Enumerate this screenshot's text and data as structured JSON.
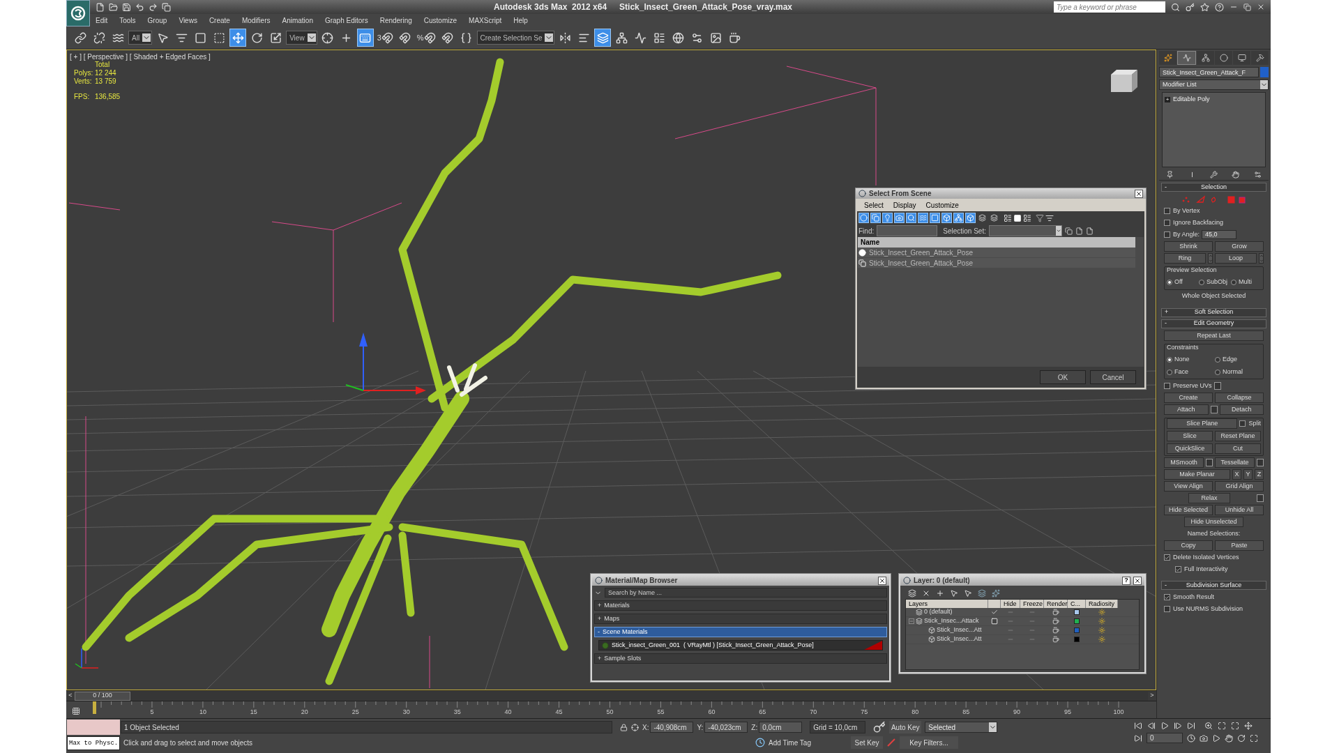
{
  "window": {
    "app_title": "Autodesk 3ds Max  2012 x64",
    "file_title": "Stick_Insect_Green_Attack_Pose_vray.max",
    "search_placeholder": "Type a keyword or phrase"
  },
  "menu": [
    "Edit",
    "Tools",
    "Group",
    "Views",
    "Create",
    "Modifiers",
    "Animation",
    "Graph Editors",
    "Rendering",
    "Customize",
    "MAXScript",
    "Help"
  ],
  "toolbar": [
    {
      "kind": "button",
      "selected": false
    },
    {
      "kind": "button",
      "selected": false
    },
    {
      "kind": "button",
      "selected": false
    },
    {
      "kind": "dropdown",
      "value": "All"
    },
    {
      "kind": "button",
      "selected": false
    },
    {
      "kind": "button",
      "selected": false
    },
    {
      "kind": "button",
      "selected": false
    },
    {
      "kind": "button",
      "selected": false
    },
    {
      "kind": "button",
      "selected": true
    },
    {
      "kind": "button",
      "selected": false
    },
    {
      "kind": "button",
      "selected": false
    },
    {
      "kind": "dropdown",
      "value": "View"
    },
    {
      "kind": "button",
      "selected": false
    },
    {
      "kind": "button",
      "selected": false
    },
    {
      "kind": "button",
      "selected": true
    },
    {
      "kind": "button",
      "selected": false,
      "label": "3"
    },
    {
      "kind": "button",
      "selected": false
    },
    {
      "kind": "button",
      "selected": false,
      "label": "%"
    },
    {
      "kind": "button",
      "selected": false
    },
    {
      "kind": "button",
      "selected": false
    },
    {
      "kind": "dropdown",
      "value": "Create Selection Se"
    },
    {
      "kind": "button",
      "selected": false
    },
    {
      "kind": "button",
      "selected": false
    },
    {
      "kind": "button",
      "selected": true
    },
    {
      "kind": "button",
      "selected": false
    },
    {
      "kind": "button",
      "selected": false
    },
    {
      "kind": "button",
      "selected": false
    },
    {
      "kind": "button",
      "selected": false
    },
    {
      "kind": "button",
      "selected": false
    },
    {
      "kind": "button",
      "selected": false
    },
    {
      "kind": "button",
      "selected": false
    }
  ],
  "viewport": {
    "label": "[ + ] [ Perspective ] [ Shaded + Edged Faces ]",
    "stats_heading": "Total",
    "stats": [
      {
        "label": "Polys:",
        "value": "12 244"
      },
      {
        "label": "Verts:",
        "value": "13 759"
      }
    ],
    "fps_label": "FPS:",
    "fps_value": "136,585"
  },
  "select_from_scene": {
    "title": "Select From Scene",
    "menu": [
      "Select",
      "Display",
      "Customize"
    ],
    "filters": [
      {
        "selected": true
      },
      {
        "selected": true
      },
      {
        "selected": true
      },
      {
        "selected": true
      },
      {
        "selected": true
      },
      {
        "selected": true
      },
      {
        "selected": true
      },
      {
        "selected": true
      },
      {
        "selected": true
      },
      {
        "selected": true
      },
      {
        "selected": false
      },
      {
        "selected": false
      }
    ],
    "find_label": "Find:",
    "selection_set_label": "Selection Set:",
    "column": "Name",
    "rows": [
      {
        "kind": "geometry",
        "name": "Stick_Insect_Green_Attack_Pose"
      },
      {
        "kind": "group",
        "name": "Stick_Insect_Green_Attack_Pose"
      }
    ],
    "buttons": [
      "OK",
      "Cancel"
    ]
  },
  "material_browser": {
    "title": "Material/Map Browser",
    "search_placeholder": "Search by Name ...",
    "items": [
      {
        "kind": "section",
        "sign": "+",
        "label": "Materials",
        "selected": false
      },
      {
        "kind": "section",
        "sign": "+",
        "label": "Maps",
        "selected": false
      },
      {
        "kind": "section",
        "sign": "-",
        "label": "Scene Materials",
        "selected": true
      },
      {
        "kind": "material",
        "label": "Stick_insect_Green_001  ( VRayMtl ) [Stick_Insect_Green_Attack_Pose]"
      },
      {
        "kind": "section",
        "sign": "+",
        "label": "Sample Slots",
        "selected": false
      }
    ]
  },
  "layer_dialog": {
    "title": "Layer: 0 (default)",
    "help": "?",
    "columns": [
      "Layers",
      "Hide",
      "Freeze",
      "Render",
      "C...",
      "Radiosity"
    ],
    "rows": [
      {
        "name": "0 (default)",
        "current": true,
        "color": "#a8c8ec"
      },
      {
        "name": "Stick_Insec...Attack",
        "current": false,
        "color": "#20b050",
        "expanded": true,
        "children": [
          {
            "name": "Stick_Insec...Att",
            "color": "#2060c0"
          },
          {
            "name": "Stick_Insec...Att",
            "color": "#000000"
          }
        ]
      }
    ]
  },
  "command_panel": {
    "tabs": [
      {
        "selected": false
      },
      {
        "selected": true
      },
      {
        "selected": false
      },
      {
        "selected": false
      },
      {
        "selected": false
      },
      {
        "selected": false
      }
    ],
    "object_name": "Stick_Insect_Green_Attack_F",
    "modifier_list": "Modifier List",
    "stack": [
      {
        "sign": "+",
        "label": "Editable Poly"
      }
    ],
    "rollouts": [
      {
        "sign": "-",
        "title": "Selection",
        "expanded": true,
        "rows": [
          {
            "items": [
              {
                "kind": "subobject_icons"
              }
            ]
          },
          {
            "items": [
              {
                "kind": "checkbox",
                "label": "By Vertex",
                "checked": false
              }
            ]
          },
          {
            "items": [
              {
                "kind": "checkbox",
                "label": "Ignore Backfacing",
                "checked": false
              }
            ]
          },
          {
            "items": [
              {
                "kind": "checkbox",
                "label": "By Angle:",
                "checked": false
              },
              {
                "kind": "spinner_field",
                "value": "45,0"
              }
            ]
          },
          {
            "items": [
              {
                "kind": "button",
                "label": "Shrink"
              },
              {
                "kind": "button",
                "label": "Grow"
              }
            ]
          },
          {
            "items": [
              {
                "kind": "button",
                "label": "Ring"
              },
              {
                "kind": "spinner"
              },
              {
                "kind": "button",
                "label": "Loop"
              },
              {
                "kind": "spinner"
              }
            ]
          },
          {
            "group": "Preview Selection",
            "rows": [
              {
                "items": [
                  {
                    "kind": "radio",
                    "label": "Off",
                    "selected": true
                  },
                  {
                    "kind": "radio",
                    "label": "SubObj",
                    "selected": false
                  },
                  {
                    "kind": "radio",
                    "label": "Multi",
                    "selected": false
                  }
                ]
              }
            ]
          },
          {
            "items": [
              {
                "kind": "text",
                "label": "Whole Object Selected"
              }
            ]
          }
        ]
      },
      {
        "sign": "+",
        "title": "Soft Selection",
        "expanded": false
      },
      {
        "sign": "-",
        "title": "Edit Geometry",
        "expanded": true,
        "rows": [
          {
            "items": [
              {
                "kind": "button",
                "label": "Repeat Last"
              }
            ]
          },
          {
            "group": "Constraints",
            "rows": [
              {
                "items": [
                  {
                    "kind": "radio",
                    "label": "None",
                    "selected": true
                  },
                  {
                    "kind": "radio",
                    "label": "Edge",
                    "selected": false
                  }
                ]
              },
              {
                "items": [
                  {
                    "kind": "radio",
                    "label": "Face",
                    "selected": false
                  },
                  {
                    "kind": "radio",
                    "label": "Normal",
                    "selected": false
                  }
                ]
              }
            ]
          },
          {
            "items": [
              {
                "kind": "checkbox",
                "label": "Preserve UVs",
                "checked": false
              },
              {
                "kind": "settings"
              }
            ]
          },
          {
            "items": [
              {
                "kind": "button",
                "label": "Create"
              },
              {
                "kind": "button",
                "label": "Collapse"
              }
            ]
          },
          {
            "items": [
              {
                "kind": "button",
                "label": "Attach"
              },
              {
                "kind": "settings"
              },
              {
                "kind": "button",
                "label": "Detach"
              }
            ]
          },
          {
            "group": "",
            "rows": [
              {
                "items": [
                  {
                    "kind": "button",
                    "label": "Slice Plane"
                  },
                  {
                    "kind": "checkbox",
                    "label": "Split",
                    "checked": false
                  }
                ]
              },
              {
                "items": [
                  {
                    "kind": "button",
                    "label": "Slice"
                  },
                  {
                    "kind": "button",
                    "label": "Reset Plane"
                  }
                ]
              },
              {
                "items": [
                  {
                    "kind": "button",
                    "label": "QuickSlice"
                  },
                  {
                    "kind": "button",
                    "label": "Cut"
                  }
                ]
              }
            ]
          },
          {
            "items": [
              {
                "kind": "button",
                "label": "MSmooth"
              },
              {
                "kind": "settings"
              },
              {
                "kind": "button",
                "label": "Tessellate"
              },
              {
                "kind": "settings"
              }
            ]
          },
          {
            "items": [
              {
                "kind": "button",
                "label": "Make Planar"
              },
              {
                "kind": "small_button",
                "label": "X"
              },
              {
                "kind": "small_button",
                "label": "Y"
              },
              {
                "kind": "small_button",
                "label": "Z"
              }
            ]
          },
          {
            "items": [
              {
                "kind": "button",
                "label": "View Align"
              },
              {
                "kind": "button",
                "label": "Grid Align"
              }
            ]
          },
          {
            "items": [
              {
                "kind": "center_button",
                "label": "Relax"
              },
              {
                "kind": "settings"
              }
            ]
          },
          {
            "items": [
              {
                "kind": "button",
                "label": "Hide Selected"
              },
              {
                "kind": "button",
                "label": "Unhide All"
              }
            ]
          },
          {
            "items": [
              {
                "kind": "center_button",
                "label": "Hide Unselected"
              }
            ]
          },
          {
            "items": [
              {
                "kind": "text",
                "label": "Named Selections:"
              }
            ]
          },
          {
            "items": [
              {
                "kind": "button",
                "label": "Copy"
              },
              {
                "kind": "button",
                "label": "Paste"
              }
            ]
          },
          {
            "items": [
              {
                "kind": "checkbox",
                "label": "Delete Isolated Vertices",
                "checked": true
              }
            ]
          },
          {
            "items": [
              {
                "kind": "indented_checkbox",
                "label": "Full Interactivity",
                "checked": true
              }
            ]
          }
        ]
      },
      {
        "sign": "-",
        "title": "Subdivision Surface",
        "expanded": true,
        "rows": [
          {
            "items": [
              {
                "kind": "checkbox",
                "label": "Smooth Result",
                "checked": true
              }
            ]
          },
          {
            "items": [
              {
                "kind": "checkbox",
                "label": "Use NURMS Subdivision",
                "checked": false
              }
            ]
          }
        ]
      }
    ]
  },
  "timeline": {
    "prev": "<",
    "position": "0 / 100",
    "level": 0,
    "next": ">",
    "ticks": [
      "5",
      "10",
      "15",
      "20",
      "25",
      "30",
      "35",
      "40",
      "45",
      "50",
      "55",
      "60",
      "65",
      "70",
      "75",
      "80",
      "85",
      "90",
      "95",
      "100"
    ]
  },
  "status_bar": {
    "listener": "Max to Physc.",
    "selection": "1 Object Selected",
    "prompt": "Click and drag to select and move objects",
    "coords": [
      {
        "label": "X:",
        "value": "-40,908cm"
      },
      {
        "label": "Y:",
        "value": "-40,023cm"
      },
      {
        "label": "Z:",
        "value": "0,0cm"
      }
    ],
    "grid": "Grid = 10,0cm",
    "add_time_tag": "Add Time Tag",
    "auto_key": "Auto Key",
    "set_key": "Set Key",
    "key_mode": "Selected",
    "key_filters": "Key Filters...",
    "frame": "0"
  }
}
